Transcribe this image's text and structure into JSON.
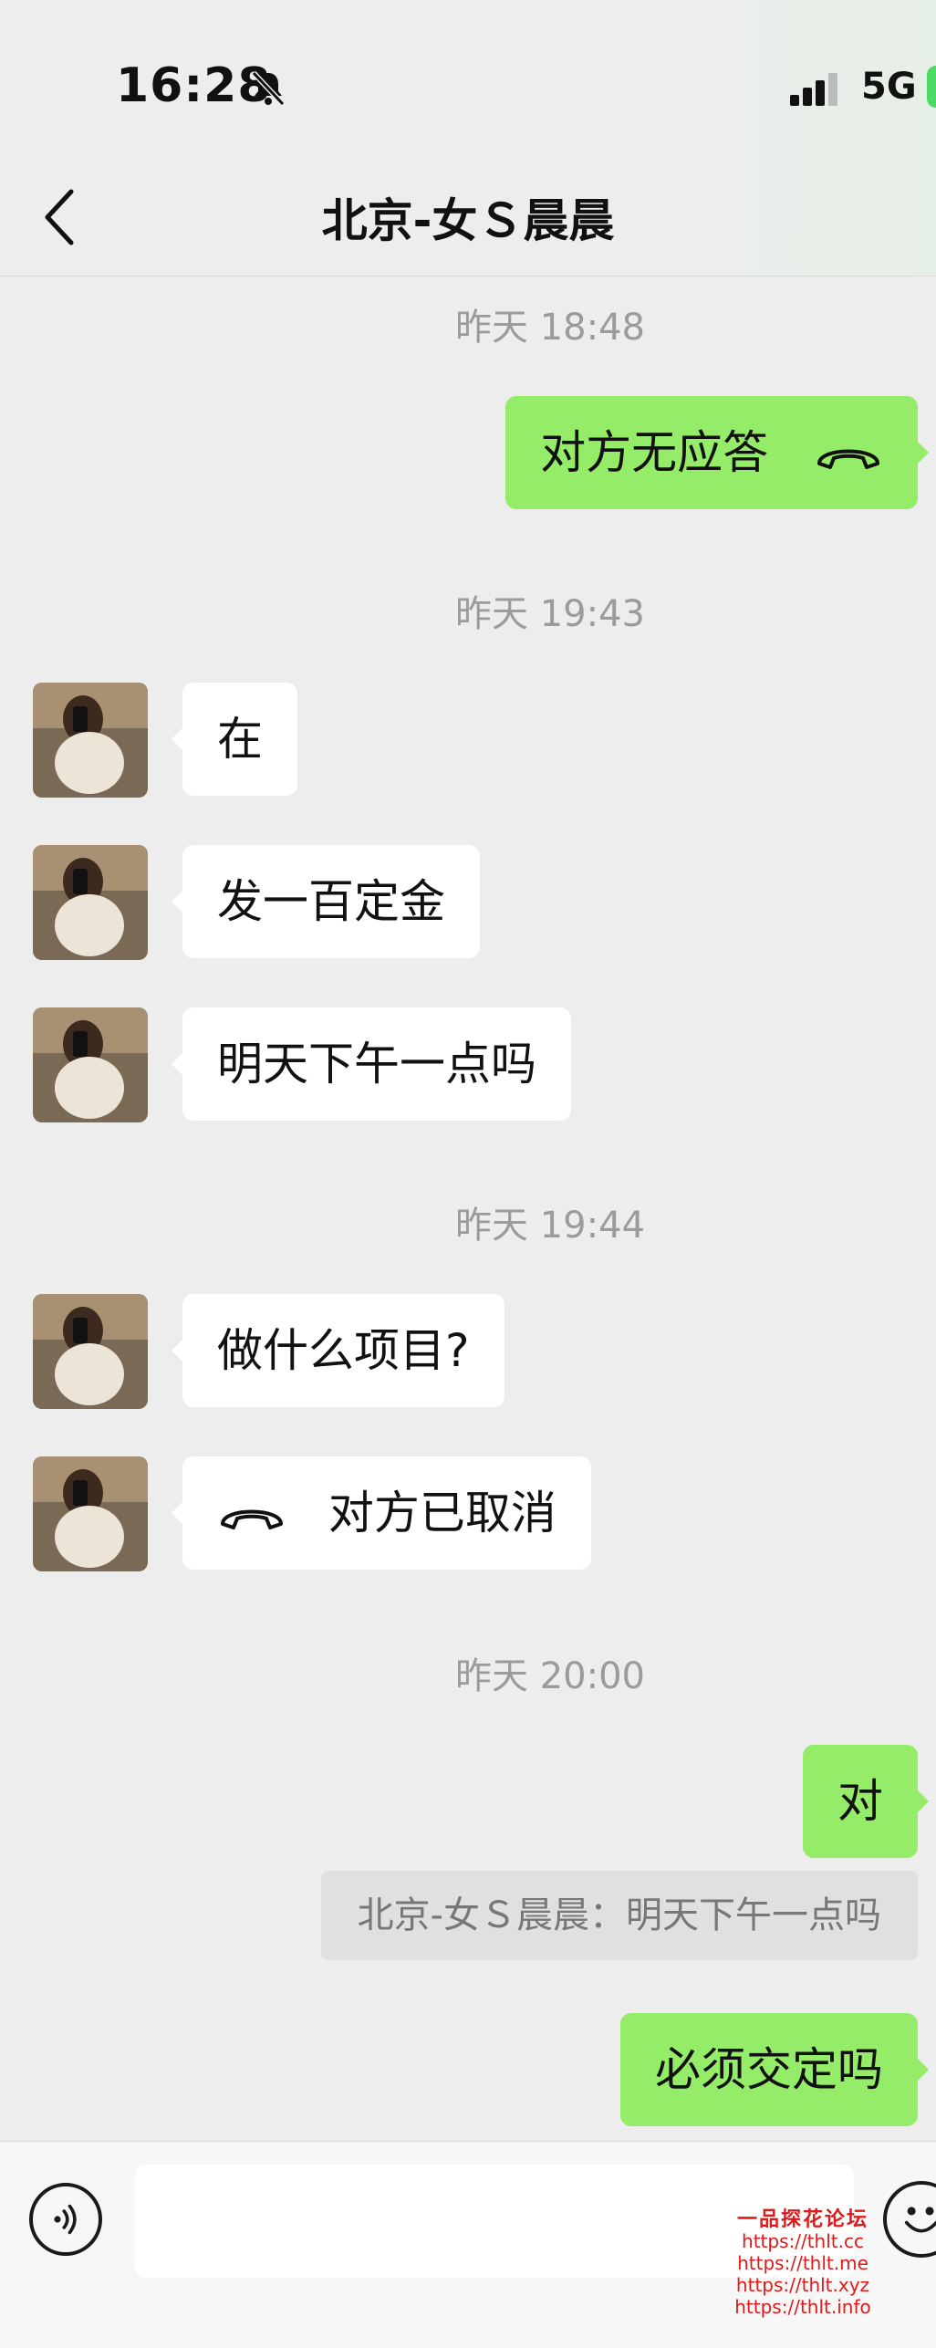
{
  "status_bar": {
    "time": "16:28",
    "network": "5G"
  },
  "header": {
    "title": "北京-女Ｓ晨晨"
  },
  "messages": [
    {
      "type": "timestamp",
      "text": "昨天 18:48"
    },
    {
      "type": "sent",
      "text": "对方无应答",
      "icon": "phone-hangup-icon"
    },
    {
      "type": "timestamp",
      "text": "昨天 19:43"
    },
    {
      "type": "received",
      "text": "在"
    },
    {
      "type": "received",
      "text": "发一百定金"
    },
    {
      "type": "received",
      "text": "明天下午一点吗"
    },
    {
      "type": "timestamp",
      "text": "昨天 19:44"
    },
    {
      "type": "received",
      "text": "做什么项目?"
    },
    {
      "type": "received",
      "text": "对方已取消",
      "icon": "phone-hangup-icon"
    },
    {
      "type": "timestamp",
      "text": "昨天 20:00"
    },
    {
      "type": "sent",
      "text": "对"
    },
    {
      "type": "quote",
      "text": "北京-女Ｓ晨晨：明天下午一点吗"
    },
    {
      "type": "sent",
      "text": "必须交定吗"
    }
  ],
  "input_bar": {
    "value": ""
  },
  "watermark": {
    "title": "一品探花论坛",
    "urls": [
      "https://thlt.cc",
      "https://thlt.me",
      "https://thlt.xyz",
      "https://thlt.info"
    ]
  },
  "colors": {
    "sent_bubble": "#95ec69",
    "received_bubble": "#ffffff",
    "background": "#ededed",
    "watermark": "#e01a1a"
  }
}
